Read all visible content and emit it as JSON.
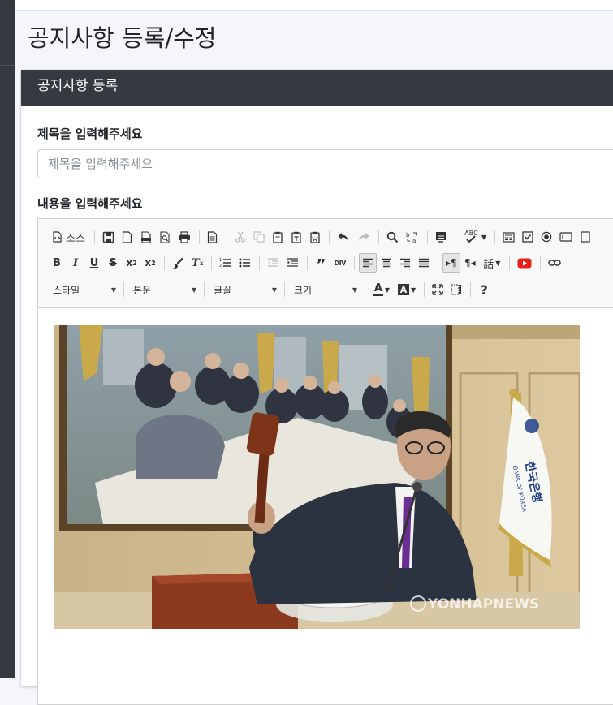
{
  "page": {
    "title": "공지사항 등록/수정"
  },
  "card": {
    "header": "공지사항 등록"
  },
  "form": {
    "title_label": "제목을 입력해주세요",
    "title_placeholder": "제목을 입력해주세요",
    "title_value": "",
    "content_label": "내용을 입력해주세요"
  },
  "toolbar": {
    "source_label": "소스",
    "style_combo": "스타일",
    "format_combo": "본문",
    "font_combo": "글꼴",
    "size_combo": "크기",
    "spellcheck_label": "ABC",
    "div_label": "DIV",
    "help_label": "?"
  },
  "image": {
    "watermark": "YONHAPNEWS",
    "flag_text": "한국은행",
    "flag_subtext": "BANK OF KOREA"
  },
  "colors": {
    "sidebar": "#343a40",
    "card_header": "#343a40",
    "youtube_red": "#e62117"
  }
}
